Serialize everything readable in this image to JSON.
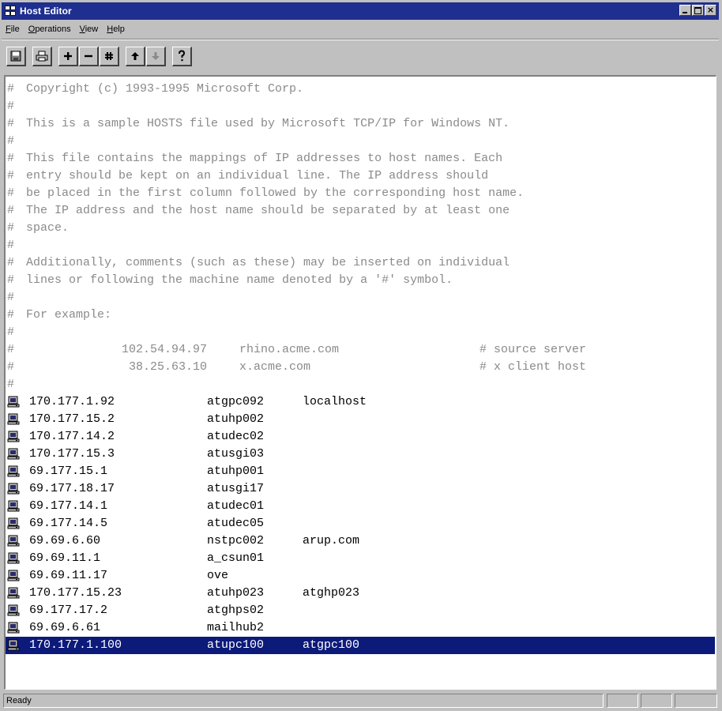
{
  "window": {
    "title": "Host Editor"
  },
  "menu": [
    {
      "label": "File",
      "u": "F",
      "rest": "ile"
    },
    {
      "label": "Operations",
      "u": "O",
      "rest": "perations"
    },
    {
      "label": "View",
      "u": "V",
      "rest": "iew"
    },
    {
      "label": "Help",
      "u": "H",
      "rest": "elp"
    }
  ],
  "toolbar": [
    "save-icon",
    "print-icon",
    "add-icon",
    "remove-icon",
    "hash-icon",
    "move-up-icon",
    "move-down-icon",
    "help-icon"
  ],
  "comments": [
    "Copyright (c) 1993-1995 Microsoft Corp.",
    "",
    "This is a sample HOSTS file used by Microsoft TCP/IP for Windows NT.",
    "",
    "This file contains the mappings of IP addresses to host names. Each",
    "entry should be kept on an individual line. The IP address should",
    "be placed in the first column followed by the corresponding host name.",
    "The IP address and the host name should be separated by at least one",
    "space.",
    "",
    "Additionally, comments (such as these) may be inserted on individual",
    "lines or following the machine name denoted by a '#' symbol.",
    "",
    "For example:",
    ""
  ],
  "examples": [
    {
      "ip": "102.54.94.97",
      "host": "rhino.acme.com",
      "comment": "# source server"
    },
    {
      "ip": "38.25.63.10",
      "host": "x.acme.com",
      "comment": "# x client host"
    }
  ],
  "comment_mark": "#",
  "entries": [
    {
      "ip": "170.177.1.92",
      "host": "atgpc092",
      "alias": "localhost"
    },
    {
      "ip": "170.177.15.2",
      "host": "atuhp002",
      "alias": ""
    },
    {
      "ip": "170.177.14.2",
      "host": "atudec02",
      "alias": ""
    },
    {
      "ip": "170.177.15.3",
      "host": "atusgi03",
      "alias": ""
    },
    {
      "ip": "69.177.15.1",
      "host": "atuhp001",
      "alias": ""
    },
    {
      "ip": "69.177.18.17",
      "host": "atusgi17",
      "alias": ""
    },
    {
      "ip": "69.177.14.1",
      "host": "atudec01",
      "alias": ""
    },
    {
      "ip": "69.177.14.5",
      "host": "atudec05",
      "alias": ""
    },
    {
      "ip": "69.69.6.60",
      "host": "nstpc002",
      "alias": "arup.com"
    },
    {
      "ip": "69.69.11.1",
      "host": "a_csun01",
      "alias": ""
    },
    {
      "ip": "69.69.11.17",
      "host": "ove",
      "alias": ""
    },
    {
      "ip": "170.177.15.23",
      "host": "atuhp023",
      "alias": "atghp023"
    },
    {
      "ip": "69.177.17.2",
      "host": "atghps02",
      "alias": ""
    },
    {
      "ip": "69.69.6.61",
      "host": "mailhub2",
      "alias": ""
    },
    {
      "ip": "170.177.1.100",
      "host": "atupc100",
      "alias": "atgpc100",
      "selected": true
    }
  ],
  "status": {
    "text": "Ready"
  },
  "colors": {
    "titlebar": "#1f2f8f",
    "selection": "#0c1a7a",
    "comment": "#8a8a8a"
  }
}
